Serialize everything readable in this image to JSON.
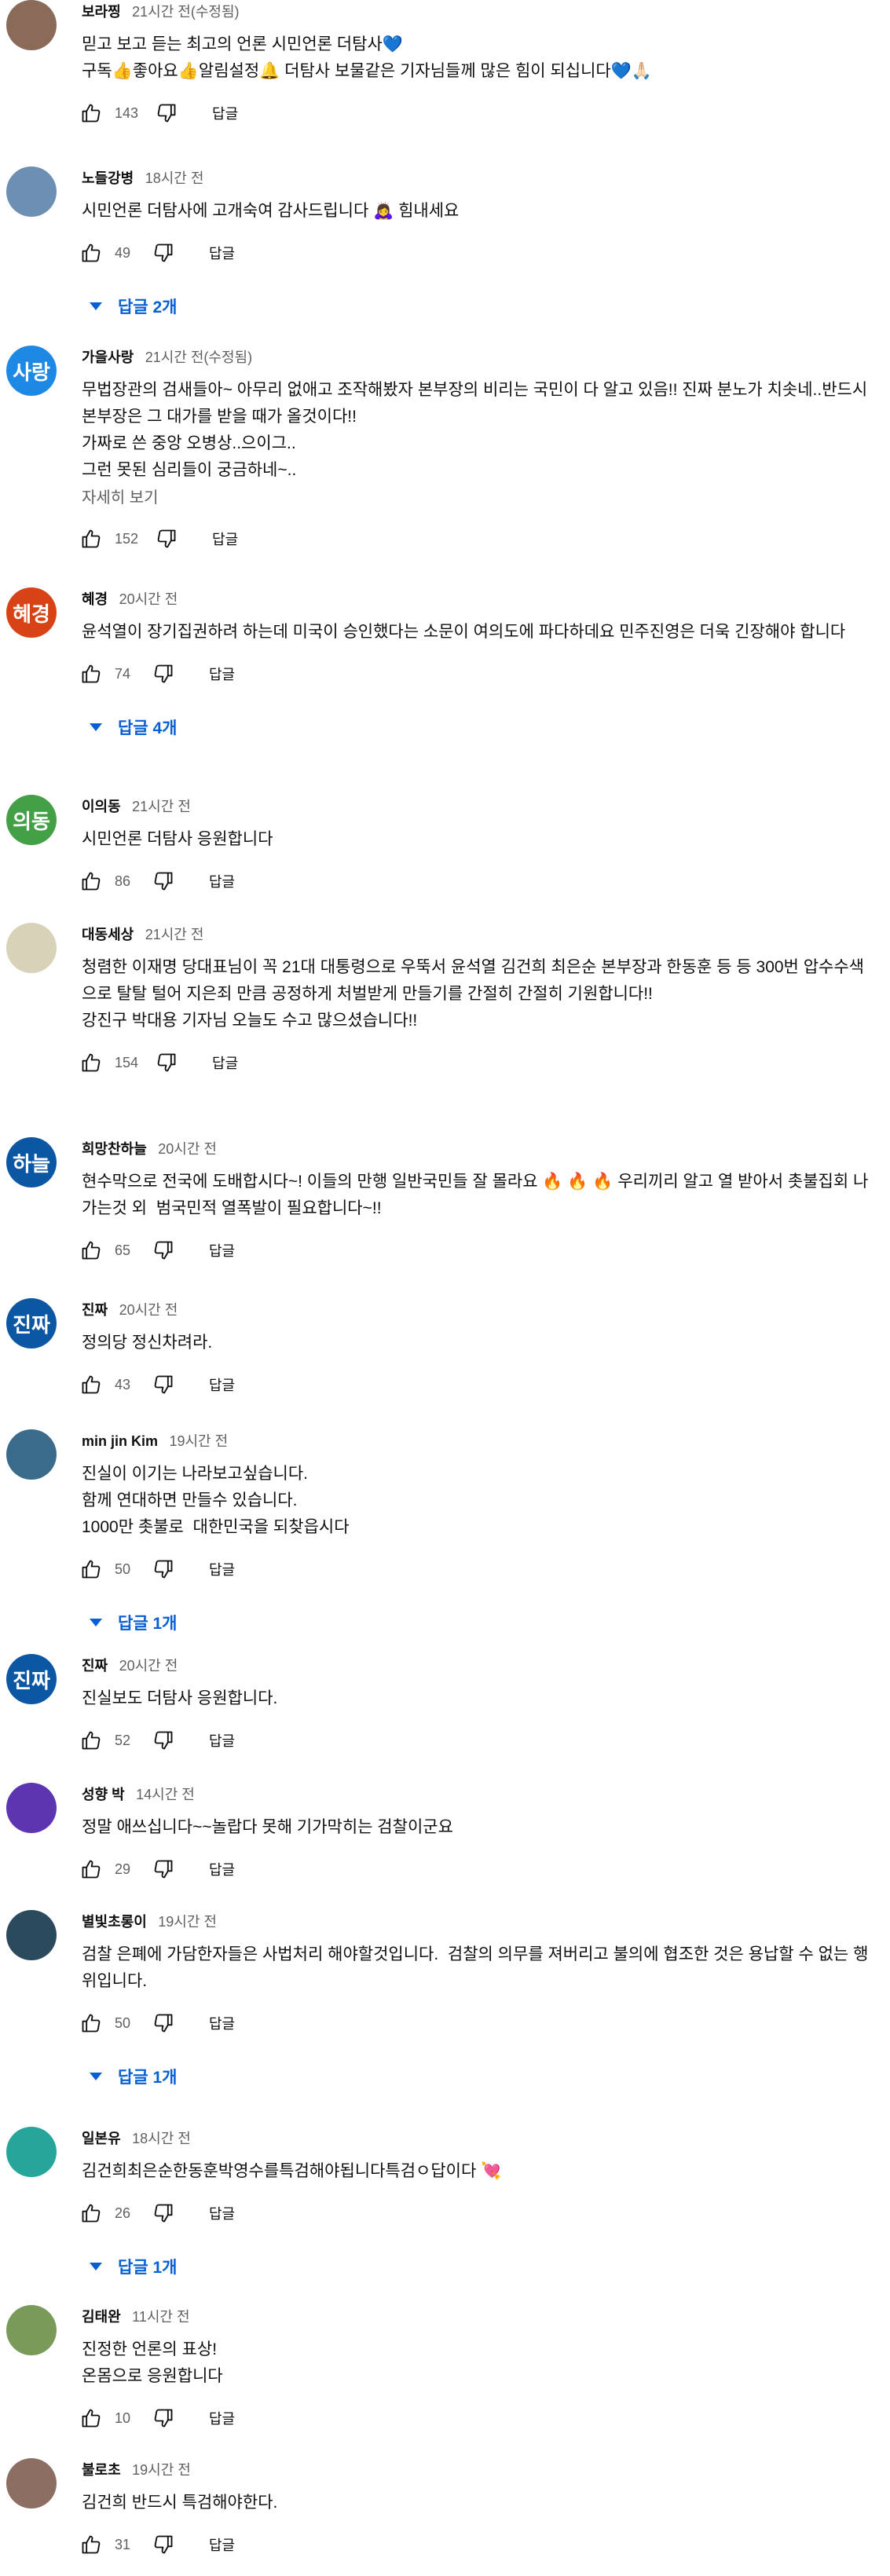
{
  "labels": {
    "reply": "답글",
    "show_more": "자세히 보기"
  },
  "comments": [
    {
      "author": "보라찡",
      "time": "21시간 전(수정됨)",
      "avatar_text": "",
      "avatar_color": "#8a6a58",
      "text": "믿고 보고 듣는 최고의 언론 시민언론 더탐사💙\n구독👍좋아요👍알림설정🔔 더탐사 보물같은 기자님들께 많은 힘이 되십니다💙🙏🏻",
      "likes": "143"
    },
    {
      "author": "노들강병",
      "time": "18시간 전",
      "avatar_text": "",
      "avatar_color": "#6e8fb4",
      "text": "시민언론 더탐사에 고개숙여 감사드립니다 🙇‍♀️ 힘내세요",
      "likes": "49",
      "replies": "답글 2개"
    },
    {
      "author": "가을사랑",
      "time": "21시간 전(수정됨)",
      "avatar_text": "사랑",
      "avatar_color": "#1e88e5",
      "text": "무법장관의 검새들아~ 아무리 없애고 조작해봤자 본부장의 비리는 국민이 다 알고 있음!! 진짜 분노가 치솟네..반드시 본부장은 그 대가를 받을 때가 올것이다!!\n가짜로 쓴 중앙 오병상..으이그..\n그런 못된 심리들이 궁금하네~..",
      "likes": "152",
      "show_more": true
    },
    {
      "author": "혜경",
      "time": "20시간 전",
      "avatar_text": "혜경",
      "avatar_color": "#d84315",
      "text": "윤석열이 장기집권하려 하는데 미국이 승인했다는 소문이 여의도에 파다하데요 민주진영은 더욱 긴장해야 합니다",
      "likes": "74",
      "replies": "답글 4개"
    },
    {
      "author": "이의동",
      "time": "21시간 전",
      "avatar_text": "의동",
      "avatar_color": "#43a047",
      "text": "시민언론 더탐사 응원합니다",
      "likes": "86"
    },
    {
      "author": "대동세상",
      "time": "21시간 전",
      "avatar_text": "",
      "avatar_color": "#d8d2b8",
      "text": "청렴한 이재명 당대표님이 꼭 21대 대통령으로 우뚝서 윤석열 김건희 최은순 본부장과 한동훈 등 등 300번 압수수색으로 탈탈 털어 지은죄 만큼 공정하게 처벌받게 만들기를 간절히 간절히 기원합니다!!\n강진구 박대용 기자님 오늘도 수고 많으셨습니다!!",
      "likes": "154"
    },
    {
      "author": "희망찬하늘",
      "time": "20시간 전",
      "avatar_text": "하늘",
      "avatar_color": "#0b57a4",
      "text": "현수막으로 전국에 도배합시다~! 이들의 만행 일반국민들 잘 몰라요 🔥 🔥 🔥 우리끼리 알고 열 받아서 촛불집회 나가는것 외  범국민적 열폭발이 필요합니다~!!",
      "likes": "65"
    },
    {
      "author": "진짜",
      "time": "20시간 전",
      "avatar_text": "진짜",
      "avatar_color": "#0b57a4",
      "text": "정의당 정신차려라.",
      "likes": "43"
    },
    {
      "author": "min jin Kim",
      "time": "19시간 전",
      "avatar_text": "",
      "avatar_color": "#3a6b8a",
      "text": "진실이 이기는 나라보고싶습니다.\n함께 연대하면 만들수 있습니다.\n1000만 촛불로  대한민국을 되찾읍시다",
      "likes": "50",
      "replies": "답글 1개"
    },
    {
      "author": "진짜",
      "time": "20시간 전",
      "avatar_text": "진짜",
      "avatar_color": "#0b57a4",
      "text": "진실보도 더탐사 응원합니다.",
      "likes": "52"
    },
    {
      "author": "성향 박",
      "time": "14시간 전",
      "avatar_text": "",
      "avatar_color": "#5e35b1",
      "text": "정말 애쓰십니다~~놀랍다 못해 기가막히는 검찰이군요",
      "likes": "29"
    },
    {
      "author": "별빛초롱이",
      "time": "19시간 전",
      "avatar_text": "",
      "avatar_color": "#2c4a5e",
      "text": "검찰 은폐에 가담한자들은 사법처리 해야할것입니다.  검찰의 의무를 져버리고 불의에 협조한 것은 용납할 수 없는 행위입니다.",
      "likes": "50",
      "replies": "답글 1개"
    },
    {
      "author": "일본유",
      "time": "18시간 전",
      "avatar_text": "",
      "avatar_color": "#26a69a",
      "text": "김건희최은순한동훈박영수를특검해야됩니다특검ㅇ답이다 💘",
      "likes": "26",
      "replies": "답글 1개"
    },
    {
      "author": "김태완",
      "time": "11시간 전",
      "avatar_text": "",
      "avatar_color": "#7a9a5a",
      "text": "진정한 언론의 표상!\n온몸으로 응원합니다",
      "likes": "10"
    },
    {
      "author": "불로초",
      "time": "19시간 전",
      "avatar_text": "",
      "avatar_color": "#8d6e63",
      "text": "김건희 반드시 특검해야한다.",
      "likes": "31"
    }
  ]
}
